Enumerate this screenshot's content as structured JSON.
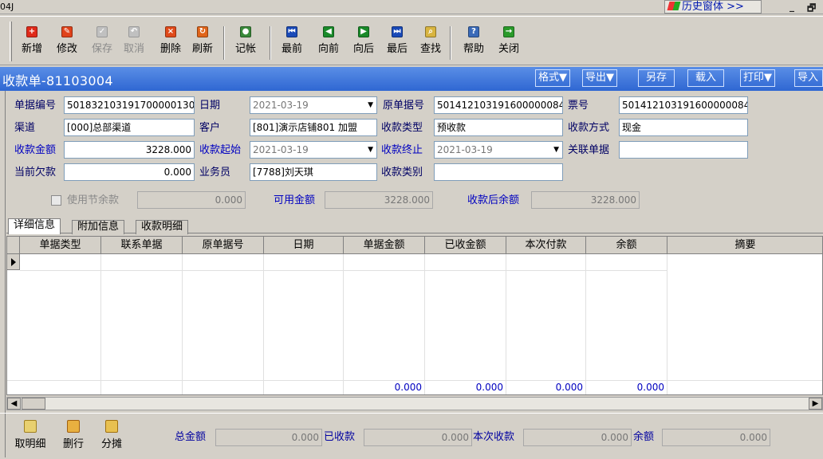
{
  "window": {
    "title_fragment": "04J",
    "history_button": "历史窗体 >>",
    "minimize": "_",
    "restore": "🗗"
  },
  "toolbar": [
    {
      "label": "新增",
      "icon": "add-icon",
      "color": "#e02a1a",
      "glyph": "+",
      "disabled": false
    },
    {
      "label": "修改",
      "icon": "edit-icon",
      "color": "#e0421a",
      "glyph": "✎",
      "disabled": false
    },
    {
      "label": "保存",
      "icon": "save-icon",
      "color": "#c0c0c0",
      "glyph": "✓",
      "disabled": true
    },
    {
      "label": "取消",
      "icon": "undo-icon",
      "color": "#c0c0c0",
      "glyph": "↶",
      "disabled": true
    },
    {
      "label": "删除",
      "icon": "delete-icon",
      "color": "#e04a1a",
      "glyph": "×",
      "disabled": false
    },
    {
      "label": "刷新",
      "icon": "refresh-icon",
      "color": "#e0641a",
      "glyph": "↻",
      "disabled": false
    },
    {
      "label": "记帐",
      "icon": "post-ledger-icon",
      "color": "#3a8a3a",
      "glyph": "●",
      "disabled": false
    },
    {
      "label": "最前",
      "icon": "first-record-icon",
      "color": "#1a4ab8",
      "glyph": "⏮",
      "disabled": false
    },
    {
      "label": "向前",
      "icon": "previous-record-icon",
      "color": "#1a8a2a",
      "glyph": "◀",
      "disabled": false
    },
    {
      "label": "向后",
      "icon": "next-record-icon",
      "color": "#1a8a2a",
      "glyph": "▶",
      "disabled": false
    },
    {
      "label": "最后",
      "icon": "last-record-icon",
      "color": "#1a4ab8",
      "glyph": "⏭",
      "disabled": false
    },
    {
      "label": "查找",
      "icon": "find-icon",
      "color": "#d8b440",
      "glyph": "⌕",
      "disabled": false
    },
    {
      "label": "帮助",
      "icon": "help-icon",
      "color": "#3a6ab8",
      "glyph": "?",
      "disabled": false
    },
    {
      "label": "关闭",
      "icon": "close-icon",
      "color": "#2a9a2a",
      "glyph": "→",
      "disabled": false
    }
  ],
  "form": {
    "title": "收款单-81103004",
    "buttons": [
      "格式▼",
      "导出▼",
      "另存",
      "载入",
      "打印▼",
      "导入"
    ],
    "fields": {
      "doc_no": {
        "label": "单据编号",
        "value": "501832103191700000130"
      },
      "date": {
        "label": "日期",
        "value": "2021-03-19"
      },
      "orig_doc_no": {
        "label": "原单据号",
        "value": "501412103191600000084"
      },
      "ticket_no": {
        "label": "票号",
        "value": "501412103191600000084"
      },
      "channel": {
        "label": "渠道",
        "value": "[000]总部渠道"
      },
      "customer": {
        "label": "客户",
        "value": "[801]演示店铺801   加盟"
      },
      "receipt_type": {
        "label": "收款类型",
        "value": "预收款"
      },
      "receipt_method": {
        "label": "收款方式",
        "value": "现金"
      },
      "amount": {
        "label": "收款金额",
        "value": "3228.000"
      },
      "start": {
        "label": "收款起始",
        "value": "2021-03-19"
      },
      "end": {
        "label": "收款终止",
        "value": "2021-03-19"
      },
      "related_doc": {
        "label": "关联单据",
        "value": ""
      },
      "current_debt": {
        "label": "当前欠款",
        "value": "0.000"
      },
      "salesperson": {
        "label": "业务员",
        "value": "[7788]刘天琪"
      },
      "category": {
        "label": "收款类别",
        "value": ""
      }
    },
    "use_balance": {
      "label": "使用节余款",
      "value": "0.000"
    },
    "available": {
      "label": "可用金额",
      "value": "3228.000"
    },
    "after_balance": {
      "label": "收款后余额",
      "value": "3228.000"
    }
  },
  "tabs": [
    "详细信息",
    "附加信息",
    "收款明细"
  ],
  "grid": {
    "columns": [
      "单据类型",
      "联系单据",
      "原单据号",
      "日期",
      "单据金额",
      "已收金额",
      "本次付款",
      "余额",
      "摘要"
    ],
    "totals": {
      "doc_amount": "0.000",
      "received": "0.000",
      "payment": "0.000",
      "balance": "0.000"
    }
  },
  "bottom": {
    "buttons": [
      {
        "label": "取明细",
        "icon": "fetch-detail-icon"
      },
      {
        "label": "删行",
        "icon": "delete-row-icon"
      },
      {
        "label": "分摊",
        "icon": "allocate-icon"
      }
    ],
    "total": {
      "label": "总金额",
      "value": "0.000"
    },
    "received": {
      "label": "已收款",
      "value": "0.000"
    },
    "this_receipt": {
      "label": "本次收款",
      "value": "0.000"
    },
    "balance": {
      "label": "余额",
      "value": "0.000"
    }
  }
}
